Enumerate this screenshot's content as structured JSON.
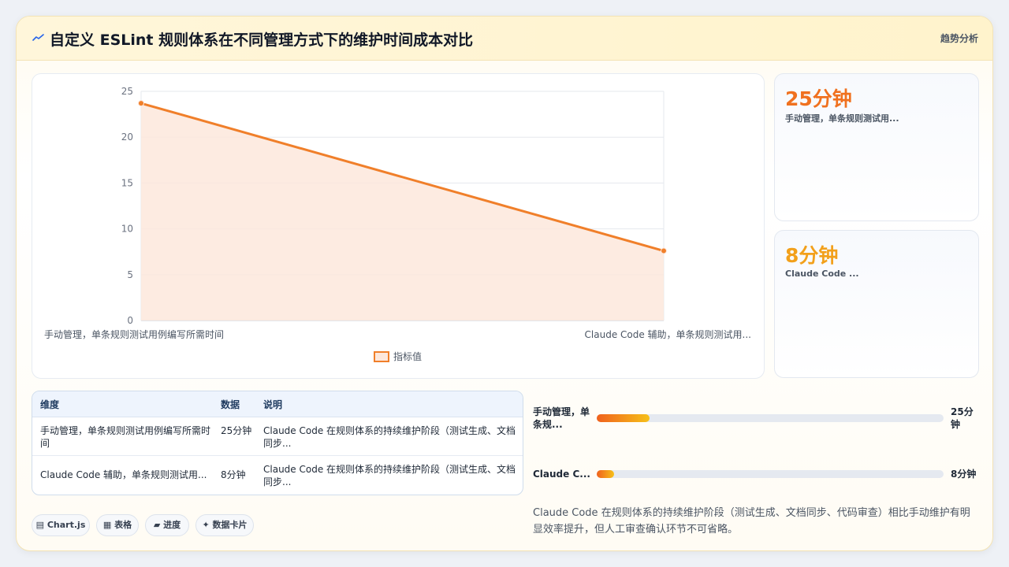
{
  "header": {
    "title": "自定义 ESLint 规则体系在不同管理方式下的维护时间成本对比",
    "right_label": "趋势分析",
    "icon": "trend-line-icon"
  },
  "chart_data": {
    "type": "area",
    "categories": [
      "手动管理，单条规则测试用例编写所需时间",
      "Claude Code 辅助，单条规则测试用..."
    ],
    "series": [
      {
        "name": "指标值",
        "values": [
          23.7,
          7.6
        ]
      }
    ],
    "ylim": [
      0,
      25
    ],
    "yticks": [
      "0",
      "5",
      "10",
      "15",
      "20",
      "25"
    ],
    "grid": true,
    "legend": "bottom",
    "color": "#f07f2a",
    "fill_color": "#fde8dc"
  },
  "kpis": [
    {
      "value": "25分钟",
      "label": "手动管理，单条规则测试用...",
      "color": "#f0711f"
    },
    {
      "value": "8分钟",
      "label": "Claude Code ...",
      "color": "#f2a01b"
    }
  ],
  "table": {
    "headers": [
      "维度",
      "数据",
      "说明"
    ],
    "rows": [
      {
        "dim": "手动管理，单条规则测试用例编写所需时间",
        "value": "25分钟",
        "desc": "Claude Code 在规则体系的持续维护阶段（测试生成、文档同步..."
      },
      {
        "dim": "Claude Code 辅助，单条规则测试用...",
        "value": "8分钟",
        "desc": "Claude Code 在规则体系的持续维护阶段（测试生成、文档同步..."
      }
    ]
  },
  "progress": [
    {
      "label": "手动管理，单条规...",
      "value": "25分钟",
      "fraction": 0.152
    },
    {
      "label": "Claude C...",
      "value": "8分钟",
      "fraction": 0.05
    }
  ],
  "note": "Claude Code 在规则体系的持续维护阶段（测试生成、文档同步、代码审查）相比手动维护有明显效率提升，但人工审查确认环节不可省略。",
  "chips": [
    {
      "label": "Chart.js",
      "icon": "chart-icon"
    },
    {
      "label": "表格",
      "icon": "table-icon"
    },
    {
      "label": "进度",
      "icon": "progress-icon"
    },
    {
      "label": "数据卡片",
      "icon": "sparkle-icon"
    }
  ]
}
